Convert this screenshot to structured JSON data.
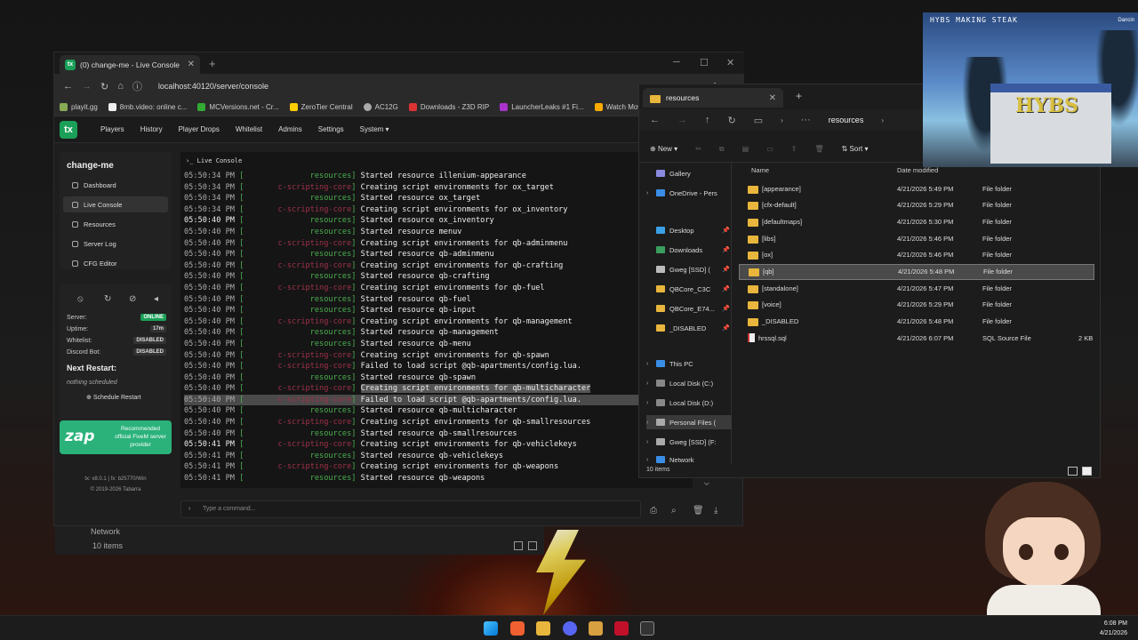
{
  "browser": {
    "tab_title": "(0) change-me - Live Console",
    "url": "localhost:40120/server/console",
    "bookmarks": [
      "playit.gg",
      "8mb.video: online c...",
      "MCVersions.net - Cr...",
      "ZeroTier Central",
      "AC12G",
      "Downloads - Z3D RIP",
      "LauncherLeaks #1 Fi...",
      "Watch Mov"
    ]
  },
  "txadmin": {
    "logo": "tx",
    "nav": [
      "Players",
      "History",
      "Player Drops",
      "Whitelist",
      "Admins",
      "Settings",
      "System"
    ],
    "server_name": "change-me",
    "sidebar": [
      "Dashboard",
      "Live Console",
      "Resources",
      "Server Log",
      "CFG Editor"
    ],
    "status": {
      "server_label": "Server:",
      "server_value": "ONLINE",
      "uptime_label": "Uptime:",
      "uptime_value": "17m",
      "whitelist_label": "Whitelist:",
      "whitelist_value": "DISABLED",
      "discord_label": "Discord Bot:",
      "discord_value": "DISABLED"
    },
    "next_restart_title": "Next Restart:",
    "next_restart_value": "nothing scheduled",
    "schedule_button": "Schedule Restart",
    "zap_logo": "zap",
    "zap_text": "Recommended official FiveM server provider",
    "version": "tx: v8.0.1 | fx: b25770/Win",
    "copyright": "© 2019-2026 Tabarra",
    "console_tab": "Live Console",
    "command_placeholder": "Type a command..."
  },
  "console_lines": [
    {
      "ts": "05:50:34 PM",
      "tag": "resources",
      "red": false,
      "text": "Started resource illenium-appearance"
    },
    {
      "ts": "05:50:34 PM",
      "tag": "c-scripting-core",
      "red": true,
      "text": "Creating script environments for ox_target"
    },
    {
      "ts": "05:50:34 PM",
      "tag": "resources",
      "red": false,
      "text": "Started resource ox_target"
    },
    {
      "ts": "05:50:34 PM",
      "tag": "c-scripting-core",
      "red": true,
      "text": "Creating script environments for ox_inventory"
    },
    {
      "ts": "05:50:40 PM",
      "tag": "resources",
      "red": false,
      "text": "Started resource ox_inventory",
      "bold": true
    },
    {
      "ts": "05:50:40 PM",
      "tag": "resources",
      "red": false,
      "text": "Started resource menuv"
    },
    {
      "ts": "05:50:40 PM",
      "tag": "c-scripting-core",
      "red": true,
      "text": "Creating script environments for qb-adminmenu"
    },
    {
      "ts": "05:50:40 PM",
      "tag": "resources",
      "red": false,
      "text": "Started resource qb-adminmenu"
    },
    {
      "ts": "05:50:40 PM",
      "tag": "c-scripting-core",
      "red": true,
      "text": "Creating script environments for qb-crafting"
    },
    {
      "ts": "05:50:40 PM",
      "tag": "resources",
      "red": false,
      "text": "Started resource qb-crafting"
    },
    {
      "ts": "05:50:40 PM",
      "tag": "c-scripting-core",
      "red": true,
      "text": "Creating script environments for qb-fuel"
    },
    {
      "ts": "05:50:40 PM",
      "tag": "resources",
      "red": false,
      "text": "Started resource qb-fuel"
    },
    {
      "ts": "05:50:40 PM",
      "tag": "resources",
      "red": false,
      "text": "Started resource qb-input"
    },
    {
      "ts": "05:50:40 PM",
      "tag": "c-scripting-core",
      "red": true,
      "text": "Creating script environments for qb-management"
    },
    {
      "ts": "05:50:40 PM",
      "tag": "resources",
      "red": false,
      "text": "Started resource qb-management"
    },
    {
      "ts": "05:50:40 PM",
      "tag": "resources",
      "red": false,
      "text": "Started resource qb-menu"
    },
    {
      "ts": "05:50:40 PM",
      "tag": "c-scripting-core",
      "red": true,
      "text": "Creating script environments for qb-spawn"
    },
    {
      "ts": "05:50:40 PM",
      "tag": "c-scripting-core",
      "red": true,
      "text": "Failed to load script @qb-apartments/config.lua."
    },
    {
      "ts": "05:50:40 PM",
      "tag": "resources",
      "red": false,
      "text": "Started resource qb-spawn"
    },
    {
      "ts": "05:50:40 PM",
      "tag": "c-scripting-core",
      "red": true,
      "text": "Creating script environments for qb-multicharacter",
      "hl": true
    },
    {
      "ts": "05:50:40 PM",
      "tag": "c-scripting-core",
      "red": true,
      "text": "Failed to load script @qb-apartments/config.lua.",
      "hl2": true
    },
    {
      "ts": "05:50:40 PM",
      "tag": "resources",
      "red": false,
      "text": "Started resource qb-multicharacter"
    },
    {
      "ts": "05:50:40 PM",
      "tag": "c-scripting-core",
      "red": true,
      "text": "Creating script environments for qb-smallresources"
    },
    {
      "ts": "05:50:40 PM",
      "tag": "resources",
      "red": false,
      "text": "Started resource qb-smallresources"
    },
    {
      "ts": "05:50:41 PM",
      "tag": "c-scripting-core",
      "red": true,
      "text": "Creating script environments for qb-vehiclekeys",
      "bold": true
    },
    {
      "ts": "05:50:41 PM",
      "tag": "resources",
      "red": false,
      "text": "Started resource qb-vehiclekeys"
    },
    {
      "ts": "05:50:41 PM",
      "tag": "c-scripting-core",
      "red": true,
      "text": "Creating script environments for qb-weapons"
    },
    {
      "ts": "05:50:41 PM",
      "tag": "resources",
      "red": false,
      "text": "Started resource qb-weapons"
    }
  ],
  "explorer": {
    "tab_title": "resources",
    "breadcrumb": "resources",
    "new_label": "New",
    "sort_label": "Sort",
    "col_name": "Name",
    "col_date": "Date modified",
    "nav_items": [
      {
        "label": "Gallery",
        "pin": false
      },
      {
        "label": "OneDrive - Pers",
        "pin": false,
        "chev": true
      },
      {
        "label": "Desktop",
        "pin": true
      },
      {
        "label": "Downloads",
        "pin": true
      },
      {
        "label": "Gweg [SSD] (",
        "pin": true
      },
      {
        "label": "QBCore_C3C",
        "pin": true
      },
      {
        "label": "QBCore_E74...",
        "pin": true
      },
      {
        "label": "_DISABLED",
        "pin": true
      },
      {
        "label": "This PC",
        "chev": true
      },
      {
        "label": "Local Disk (C:)",
        "chev": true
      },
      {
        "label": "Local Disk (D:)",
        "chev": true
      },
      {
        "label": "Personal Files (",
        "chev": true,
        "sel": true
      },
      {
        "label": "Gweg [SSD] (F:",
        "chev": true
      },
      {
        "label": "Network",
        "chev": true
      }
    ],
    "files": [
      {
        "name": "[appearance]",
        "date": "4/21/2026 5:49 PM",
        "type": "File folder",
        "size": ""
      },
      {
        "name": "[cfx-default]",
        "date": "4/21/2026 5:29 PM",
        "type": "File folder",
        "size": ""
      },
      {
        "name": "[defaultmaps]",
        "date": "4/21/2026 5:30 PM",
        "type": "File folder",
        "size": ""
      },
      {
        "name": "[libs]",
        "date": "4/21/2026 5:46 PM",
        "type": "File folder",
        "size": ""
      },
      {
        "name": "[ox]",
        "date": "4/21/2026 5:46 PM",
        "type": "File folder",
        "size": ""
      },
      {
        "name": "[qb]",
        "date": "4/21/2026 5:48 PM",
        "type": "File folder",
        "size": "",
        "sel": true
      },
      {
        "name": "[standalone]",
        "date": "4/21/2026 5:47 PM",
        "type": "File folder",
        "size": ""
      },
      {
        "name": "[voice]",
        "date": "4/21/2026 5:29 PM",
        "type": "File folder",
        "size": ""
      },
      {
        "name": "_DISABLED",
        "date": "4/21/2026 5:48 PM",
        "type": "File folder",
        "size": ""
      },
      {
        "name": "hrssql.sql",
        "date": "4/21/2026 6:07 PM",
        "type": "SQL Source File",
        "size": "2 KB"
      }
    ],
    "status": "10 items"
  },
  "ghost_explorer": {
    "network": "Network",
    "count": "10 items"
  },
  "webcam": {
    "title": "HYBS MAKING STEAK",
    "title2": "Dancin",
    "sign": "HYBS"
  },
  "taskbar": {
    "time": "6:08 PM",
    "date": "4/21/2026"
  },
  "colors": {
    "accent": "#1aa058",
    "console_green": "#4caf50",
    "console_red": "#a0314a"
  }
}
